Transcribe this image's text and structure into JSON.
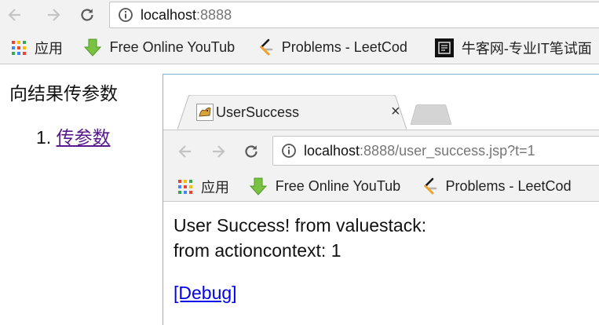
{
  "browser": {
    "url_host": "localhost",
    "url_rest": ":8888",
    "bookmarks": [
      {
        "label": "应用",
        "icon": "apps-grid-icon"
      },
      {
        "label": "Free Online YouTub",
        "icon": "download-arrow-icon"
      },
      {
        "label": "Problems - LeetCod",
        "icon": "leetcode-icon"
      },
      {
        "label": "牛客网-专业IT笔试面",
        "icon": "nowcoder-icon"
      }
    ]
  },
  "page": {
    "heading": "向结果传参数",
    "list_number": "1.",
    "link_label": "传参数"
  },
  "popup": {
    "tab_title": "UserSuccess",
    "tab_close": "×",
    "url_host": "localhost",
    "url_rest": ":8888/user_success.jsp?t=1",
    "bookmarks": [
      {
        "label": "应用",
        "icon": "apps-grid-icon"
      },
      {
        "label": "Free Online YouTub",
        "icon": "download-arrow-icon"
      },
      {
        "label": "Problems - LeetCod",
        "icon": "leetcode-icon"
      }
    ],
    "content": {
      "line1": "User Success! from valuestack:",
      "line2": "from actioncontext: 1",
      "debug_link": "[Debug]"
    }
  }
}
